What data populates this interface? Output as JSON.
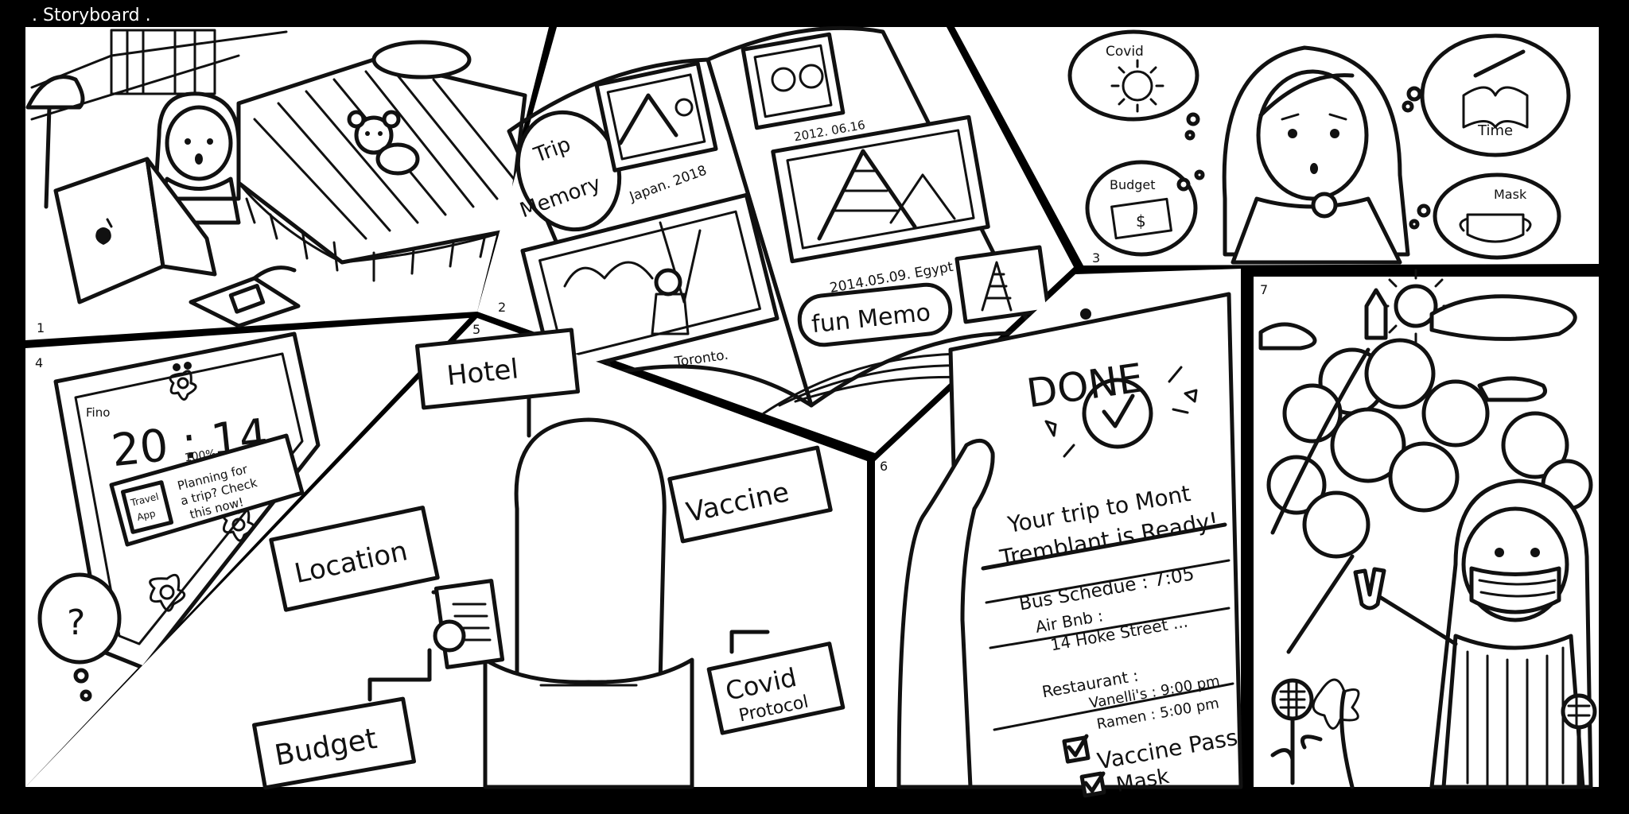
{
  "title": ". Storyboard .",
  "panels": {
    "p1": {
      "number": "1"
    },
    "p2": {
      "number": "2",
      "trip_memory_line1": "Trip",
      "trip_memory_line2": "Memory",
      "caption_japan": "Japan. 2018",
      "caption_date1": "2012. 06.16",
      "caption_egypt": "2014.05.09. Egypt",
      "caption_toronto": "Toronto.",
      "fun_memo": "fun Memo"
    },
    "p3": {
      "number": "3",
      "bubble_covid": "Covid",
      "bubble_time": "Time",
      "bubble_budget": "Budget",
      "bubble_mask": "Mask",
      "budget_symbol": "$"
    },
    "p4": {
      "number": "4",
      "carrier": "Fino",
      "clock": "20 : 14",
      "battery": "100%",
      "app_label_line1": "Travel",
      "app_label_line2": "App",
      "notif_line1": "Planning for",
      "notif_line2": "a trip? Check",
      "notif_line3": "this now!",
      "question_mark": "?"
    },
    "p5": {
      "number": "5",
      "label_hotel": "Hotel",
      "label_vaccine": "Vaccine",
      "label_location": "Location",
      "label_budget": "Budget",
      "label_covid_line1": "Covid",
      "label_covid_line2": "Protocol"
    },
    "p6": {
      "number": "6",
      "done": "DONE",
      "headline_line1": "Your trip to Mont",
      "headline_line2": "Tremblant is Ready!",
      "bus_schedule": "Bus Schedue : 7:05",
      "airbnb_label": "Air Bnb :",
      "airbnb_address": "14 Hoke Street ...",
      "restaurant_label": "Restaurant :",
      "restaurant_1": "Vanelli's : 9:00 pm",
      "restaurant_2": "Ramen : 5:00 pm",
      "check_vaccine": "Vaccine Pass",
      "check_mask": "Mask"
    },
    "p7": {
      "number": "7"
    }
  }
}
